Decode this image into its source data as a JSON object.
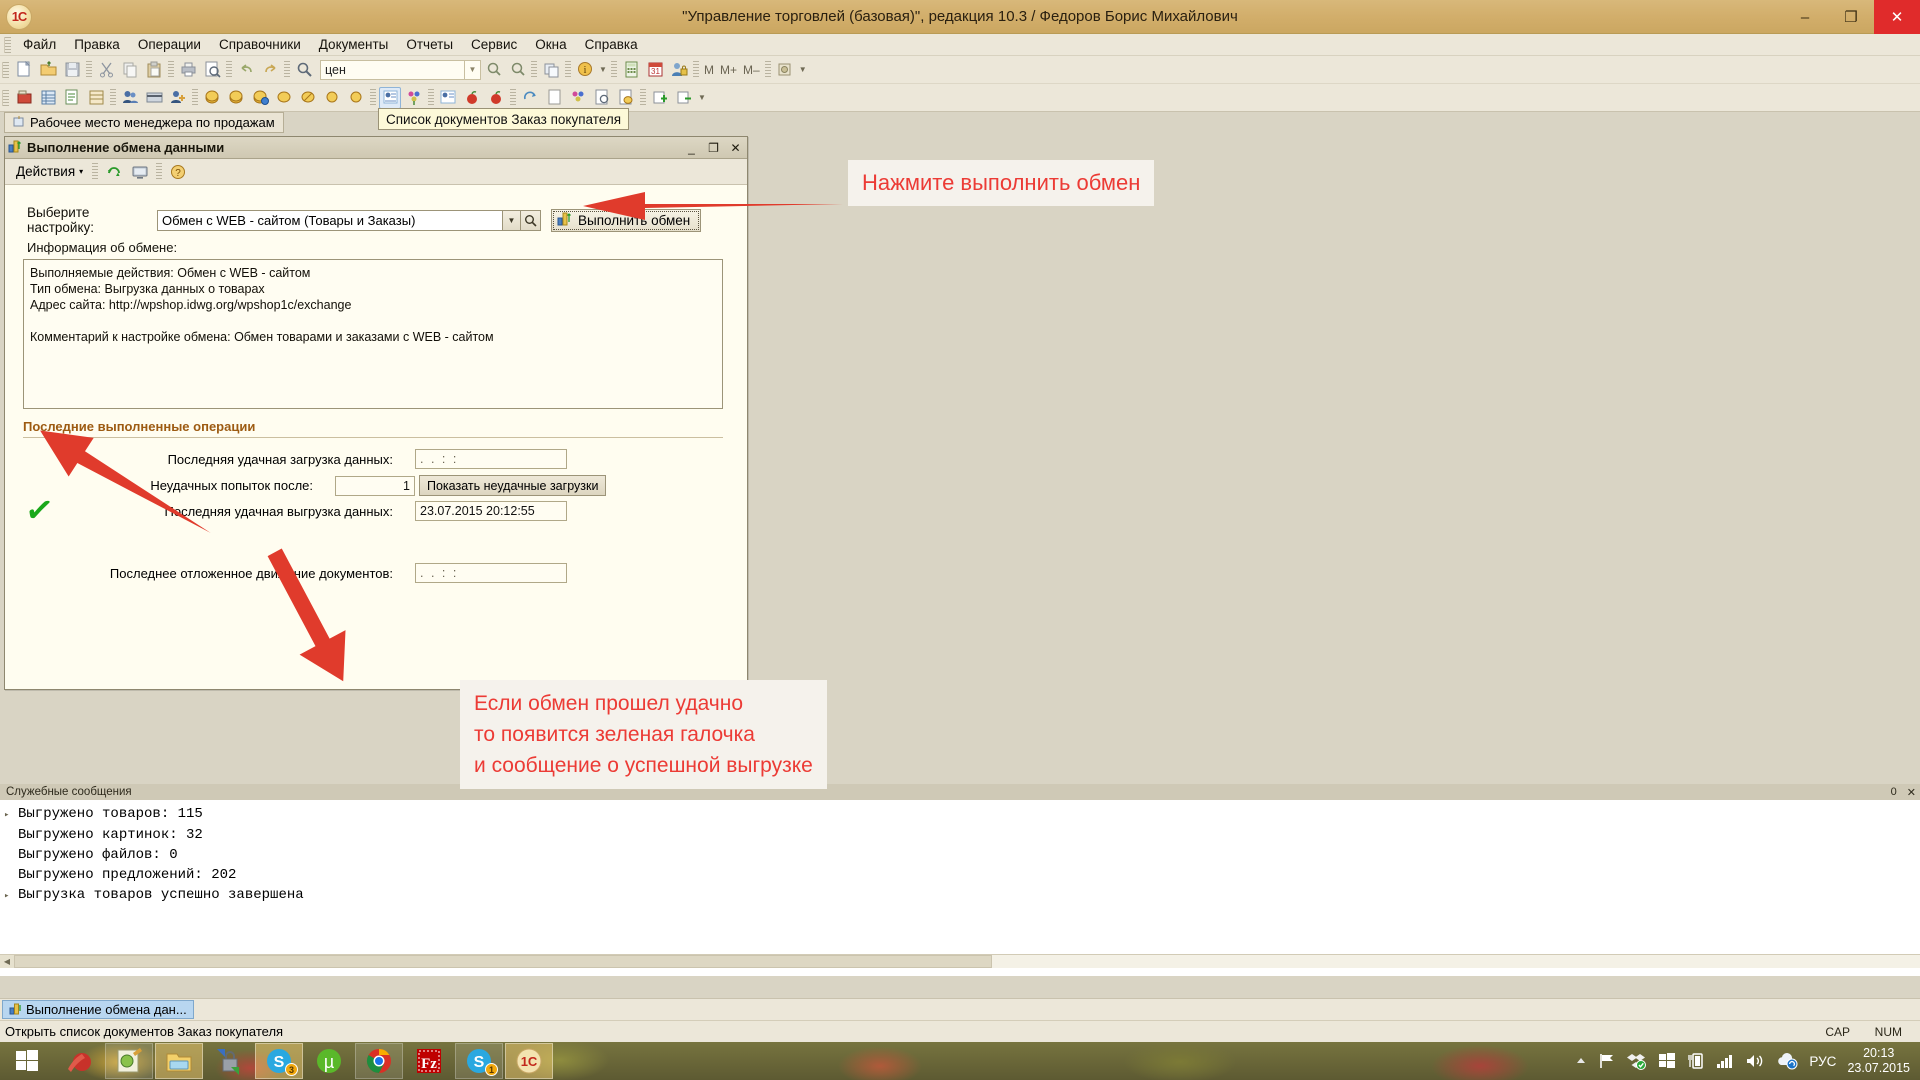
{
  "window": {
    "title": "\"Управление торговлей (базовая)\", редакция 10.3 / Федоров Борис Михайлович",
    "logo_text": "1C",
    "minimize": "–",
    "maximize": "❐",
    "close": "✕"
  },
  "menubar": {
    "items": [
      {
        "label": "Файл"
      },
      {
        "label": "Правка"
      },
      {
        "label": "Операции"
      },
      {
        "label": "Справочники"
      },
      {
        "label": "Документы"
      },
      {
        "label": "Отчеты"
      },
      {
        "label": "Сервис"
      },
      {
        "label": "Окна"
      },
      {
        "label": "Справка"
      }
    ]
  },
  "toolbar": {
    "search_value": "цен",
    "search_placeholder": "",
    "m_label": "M",
    "mplus_label": "M+",
    "mminus_label": "M–"
  },
  "mdi": {
    "workplace_tab": "Рабочее место менеджера по продажам",
    "tooltip": "Список документов Заказ покупателя"
  },
  "exchange_window": {
    "caption": "Выполнение обмена данными",
    "minimize": "_",
    "restore": "❐",
    "close": "✕",
    "actions_label": "Действия",
    "actions_caret": "▾",
    "setting_label": "Выберите настройку:",
    "setting_value": "Обмен с WEB - сайтом (Товары и Заказы)",
    "execute_button": "Выполнить обмен",
    "info_label": "Информация об обмене:",
    "info_lines": [
      "Выполняемые действия: Обмен с WEB - сайтом",
      "Тип обмена:  Выгрузка данных о товарах",
      "Адрес сайта: http://wpshop.idwg.org/wpshop1c/exchange",
      "",
      "Комментарий к настройке обмена: Обмен товарами и заказами с WEB - сайтом"
    ],
    "section_title": "Последние выполненные операции",
    "fields": [
      {
        "label": "Последняя удачная загрузка данных:",
        "value": ".  .       :  :"
      },
      {
        "label": "Неудачных попыток после:",
        "value": "1"
      },
      {
        "label": "Последняя удачная выгрузка данных:",
        "value": "23.07.2015 20:12:55"
      },
      {
        "label": "Последнее отложенное движение документов:",
        "value": ".  .       :  :"
      }
    ],
    "show_failed_button": "Показать неудачные загрузки",
    "success_check": "✓"
  },
  "annotations": {
    "first": "Нажмите выполнить обмен",
    "second": "Если обмен прошел удачно\nто появится зеленая галочка\nи сообщение о успешной выгрузке",
    "color": "#ec3b35"
  },
  "messages": {
    "header": "Служебные сообщения",
    "header_count": "0",
    "header_close": "✕",
    "lines": [
      {
        "bullet": "▸",
        "text": "Выгружено товаров: 115"
      },
      {
        "bullet": "",
        "text": "Выгружено картинок: 32"
      },
      {
        "bullet": "",
        "text": "Выгружено файлов: 0"
      },
      {
        "bullet": "",
        "text": "Выгружено предложений: 202"
      },
      {
        "bullet": "▸",
        "text": "Выгрузка товаров успешно завершена"
      }
    ]
  },
  "winbar": {
    "item": "Выполнение обмена дан..."
  },
  "statusbar": {
    "hint": "Открыть список документов Заказ покупателя",
    "caps": "CAP",
    "num": "NUM"
  },
  "taskbar": {
    "start": "start-icon",
    "tasks": [
      {
        "name": "ccleaner-icon",
        "badge": ""
      },
      {
        "name": "notepad-icon",
        "badge": ""
      },
      {
        "name": "explorer-icon",
        "badge": ""
      },
      {
        "name": "unlocker-icon",
        "badge": ""
      },
      {
        "name": "skype-icon",
        "badge": "3"
      },
      {
        "name": "utorrent-icon",
        "badge": ""
      },
      {
        "name": "chrome-icon",
        "badge": ""
      },
      {
        "name": "filezilla-icon",
        "badge": ""
      },
      {
        "name": "skype2-icon",
        "badge": "1"
      },
      {
        "name": "onec-icon",
        "badge": ""
      }
    ],
    "tray": {
      "language": "РУС",
      "time": "20:13",
      "date": "23.07.2015"
    }
  }
}
